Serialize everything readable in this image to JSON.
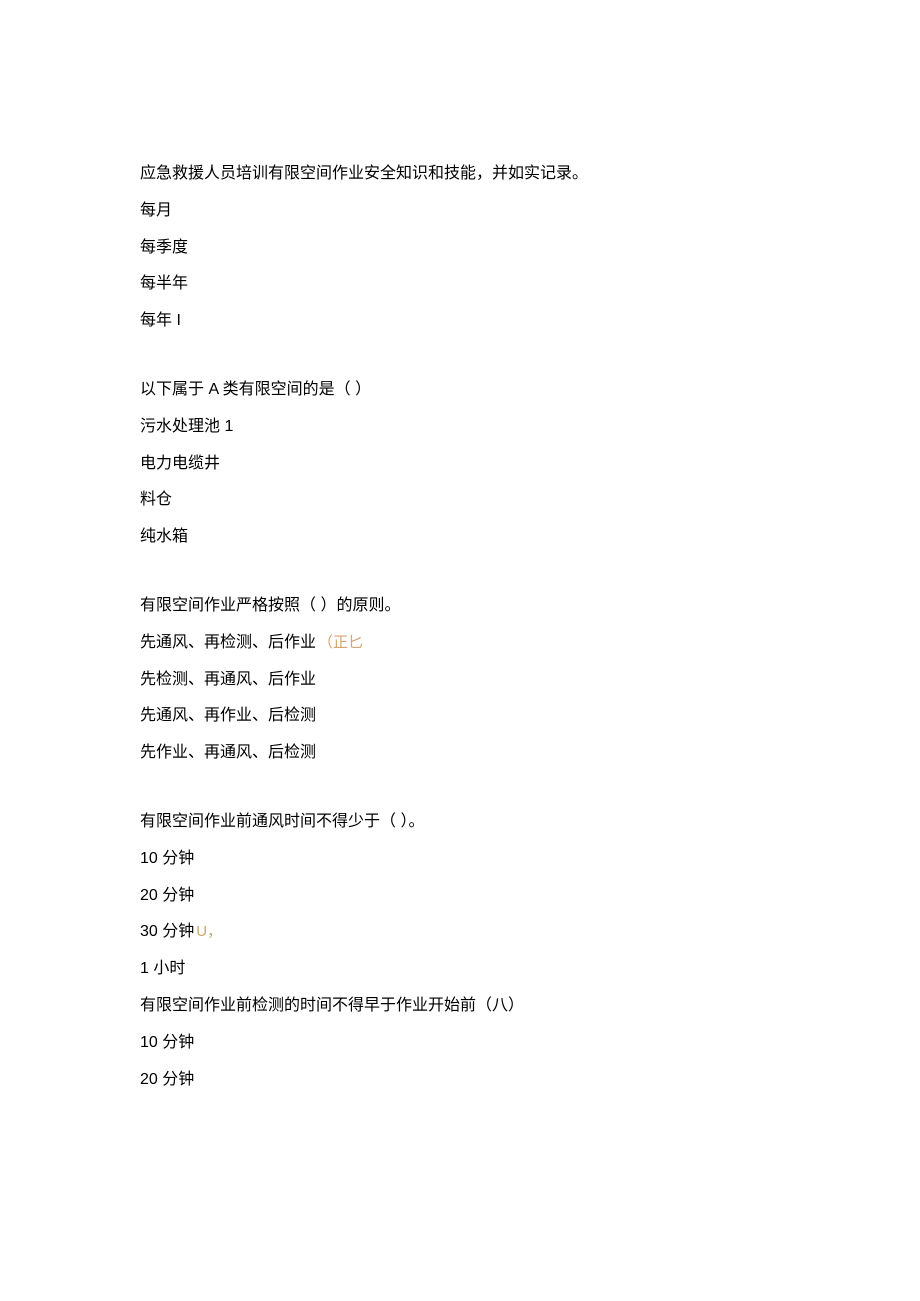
{
  "q1": {
    "stem_line": "应急救援人员培训有限空间作业安全知识和技能，并如实记录。",
    "opts": [
      "每月",
      "每季度",
      "每半年",
      "每年 I"
    ]
  },
  "q2": {
    "stem": "以下属于 A 类有限空间的是（ ）",
    "opts": [
      "污水处理池 1",
      "电力电缆井",
      "料仓",
      "纯水箱"
    ]
  },
  "q3": {
    "stem": "有限空间作业严格按照（ ）的原则。",
    "opts": [
      "先通风、再检测、后作业",
      "先检测、再通风、后作业",
      "先通风、再作业、后检测",
      "先作业、再通风、后检测"
    ],
    "opt0_annotation": "（正匕"
  },
  "q4": {
    "stem": "有限空间作业前通风时间不得少于（ ）。",
    "opts": [
      "10 分钟",
      "20 分钟",
      "30 分钟",
      "1 小时"
    ],
    "opt2_annotation": "U，"
  },
  "q5": {
    "stem": "有限空间作业前检测的时间不得早于作业开始前（八）",
    "opts": [
      "10 分钟",
      "20 分钟"
    ]
  }
}
